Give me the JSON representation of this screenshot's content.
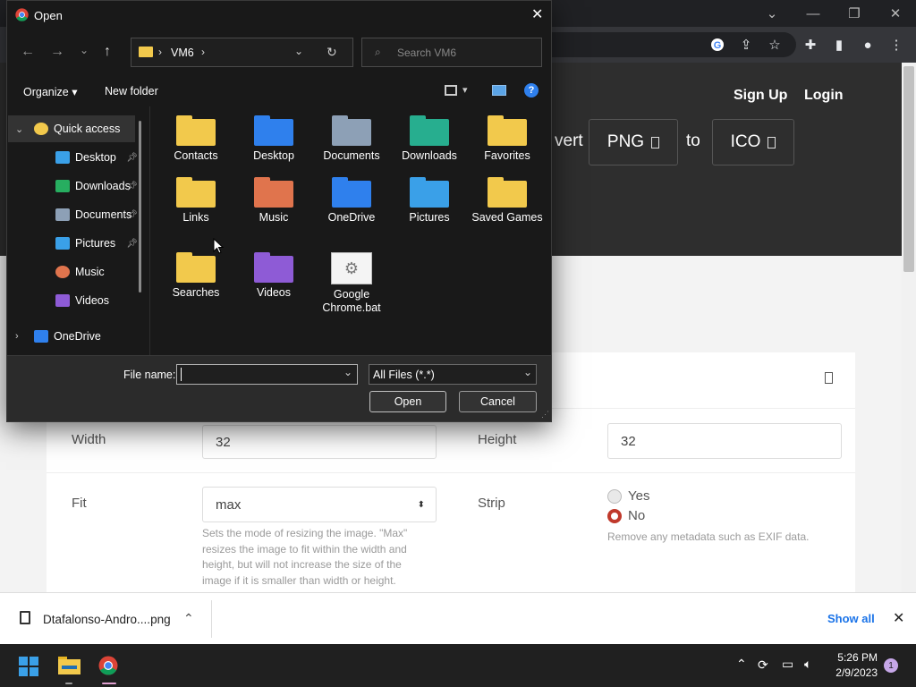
{
  "chrome": {
    "window_controls": [
      "chevron-down-icon",
      "minimize-icon",
      "restore-icon",
      "close-icon"
    ],
    "toolbar_icons": [
      "google-icon",
      "share-icon",
      "star-icon",
      "extensions-icon",
      "side-panel-icon",
      "profile-icon",
      "menu-icon"
    ]
  },
  "site": {
    "nav": {
      "signup": "Sign Up",
      "login": "Login"
    },
    "convert_partial": "vert",
    "from_format": "PNG",
    "to_word": "to",
    "to_format": "ICO",
    "options": {
      "width_label": "Width",
      "width_value": "32",
      "height_label": "Height",
      "height_value": "32",
      "fit_label": "Fit",
      "fit_value": "max",
      "fit_hint": "Sets the mode of resizing the image. \"Max\" resizes the image to fit within the width and height, but will not increase the size of the image if it is smaller than width or height.",
      "strip_label": "Strip",
      "strip_yes": "Yes",
      "strip_no": "No",
      "strip_selected": "No",
      "strip_hint": "Remove any metadata such as EXIF data."
    }
  },
  "downloads": {
    "file_name": "Dtafalonso-Andro....png",
    "show_all": "Show all"
  },
  "taskbar": {
    "time": "5:26 PM",
    "date": "2/9/2023",
    "notification_count": "1",
    "apps": [
      "windows-start-icon",
      "file-explorer-icon",
      "chrome-icon"
    ]
  },
  "dialog": {
    "title": "Open",
    "path": [
      "VM6"
    ],
    "search_placeholder": "Search VM6",
    "organize": "Organize",
    "new_folder": "New folder",
    "nav_pane": [
      {
        "label": "Quick access",
        "icon": "star-icon",
        "pinned": false
      },
      {
        "label": "Desktop",
        "icon": "desktop-icon",
        "pinned": true
      },
      {
        "label": "Downloads",
        "icon": "download-icon",
        "pinned": true
      },
      {
        "label": "Documents",
        "icon": "documents-icon",
        "pinned": true
      },
      {
        "label": "Pictures",
        "icon": "pictures-icon",
        "pinned": true
      },
      {
        "label": "Music",
        "icon": "music-icon",
        "pinned": false
      },
      {
        "label": "Videos",
        "icon": "videos-icon",
        "pinned": false
      },
      {
        "label": "OneDrive",
        "icon": "onedrive-icon",
        "pinned": false
      }
    ],
    "files": [
      {
        "label": "Contacts",
        "color": "#f2c94c"
      },
      {
        "label": "Desktop",
        "color": "#2f80ed"
      },
      {
        "label": "Documents",
        "color": "#8da0b6"
      },
      {
        "label": "Downloads",
        "color": "#27ae8f"
      },
      {
        "label": "Favorites",
        "color": "#f2c94c"
      },
      {
        "label": "Links",
        "color": "#f2c94c"
      },
      {
        "label": "Music",
        "color": "#e0744d"
      },
      {
        "label": "OneDrive",
        "color": "#2f80ed"
      },
      {
        "label": "Pictures",
        "color": "#3aa0e8"
      },
      {
        "label": "Saved Games",
        "color": "#f2c94c"
      },
      {
        "label": "Searches",
        "color": "#f2c94c"
      },
      {
        "label": "Videos",
        "color": "#8e5bd6"
      },
      {
        "label": "Google Chrome.bat",
        "color": "#dddddd"
      }
    ],
    "file_name_label": "File name:",
    "file_name_value": "",
    "file_type": "All Files (*.*)",
    "open_button": "Open",
    "cancel_button": "Cancel"
  }
}
